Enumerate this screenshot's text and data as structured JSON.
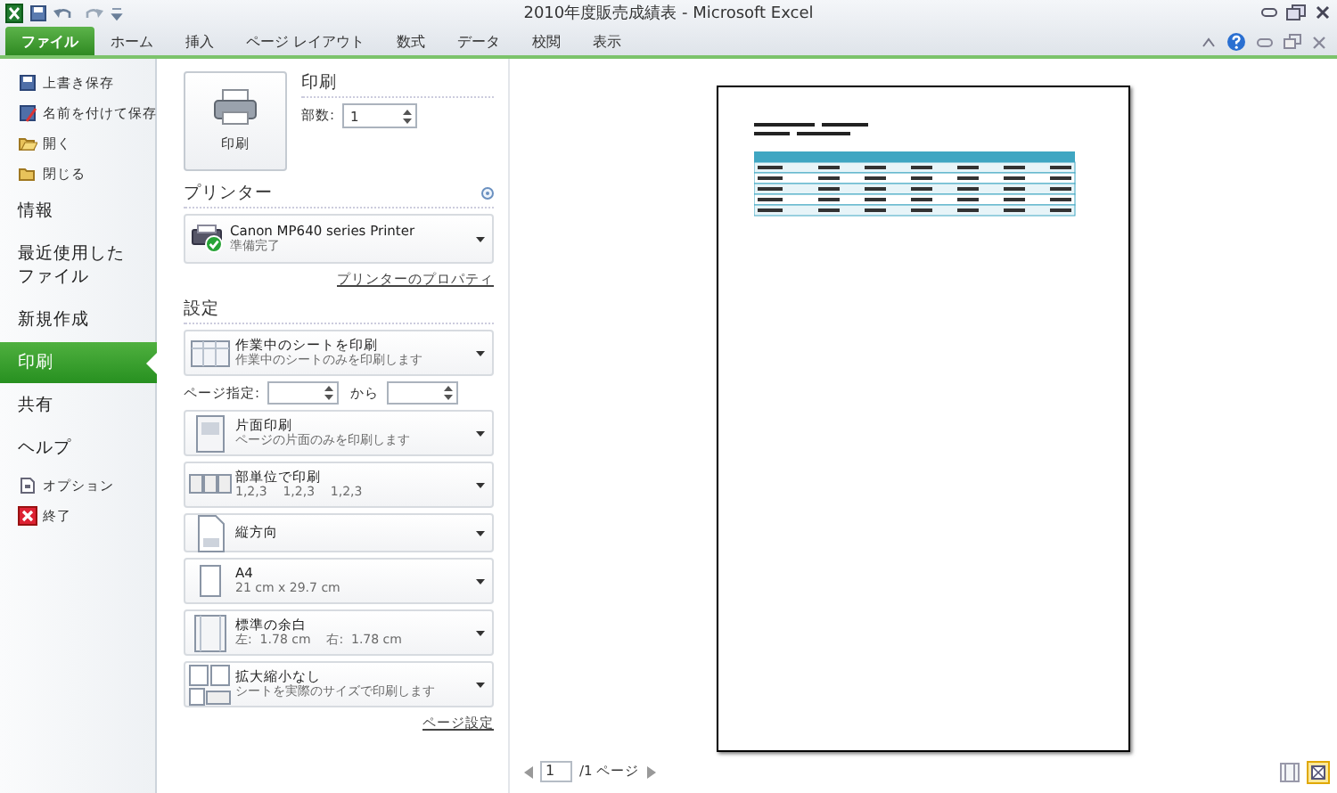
{
  "title_bar": {
    "title": "2010年度販売成績表 - Microsoft Excel"
  },
  "ribbon_tabs": [
    {
      "label": "ファイル",
      "selected": true
    },
    {
      "label": "ホーム",
      "selected": false
    },
    {
      "label": "挿入",
      "selected": false
    },
    {
      "label": "ページ レイアウト",
      "selected": false
    },
    {
      "label": "数式",
      "selected": false
    },
    {
      "label": "データ",
      "selected": false
    },
    {
      "label": "校閲",
      "selected": false
    },
    {
      "label": "表示",
      "selected": false
    }
  ],
  "backstage_nav": [
    {
      "label": "上書き保存",
      "kind": "save",
      "selected": false
    },
    {
      "label": "名前を付けて保存",
      "kind": "saveas",
      "selected": false
    },
    {
      "label": "開く",
      "kind": "open",
      "selected": false
    },
    {
      "label": "閉じる",
      "kind": "close",
      "selected": false
    },
    {
      "label": "情報",
      "kind": "section",
      "selected": false
    },
    {
      "label": "最近使用したファイル",
      "kind": "section",
      "selected": false
    },
    {
      "label": "新規作成",
      "kind": "section",
      "selected": false
    },
    {
      "label": "印刷",
      "kind": "section",
      "selected": true
    },
    {
      "label": "共有",
      "kind": "section",
      "selected": false
    },
    {
      "label": "ヘルプ",
      "kind": "section",
      "selected": false
    },
    {
      "label": "オプション",
      "kind": "options",
      "selected": false
    },
    {
      "label": "終了",
      "kind": "exit",
      "selected": false
    }
  ],
  "print": {
    "button": "印刷",
    "heading": "印刷",
    "copies_label": "部数:",
    "copies": "1"
  },
  "printer": {
    "heading": "プリンター",
    "name": "Canon MP640 series Printer",
    "status": "準備完了",
    "properties_link": "プリンターのプロパティ"
  },
  "settings": {
    "heading": "設定",
    "pages_label": "ページ指定:",
    "to_label": "から",
    "page_setup_link": "ページ設定",
    "options": [
      {
        "kind": "sheet",
        "title": "作業中のシートを印刷",
        "subtitle": "作業中のシートのみを印刷します"
      },
      {
        "kind": "sides",
        "title": "片面印刷",
        "subtitle": "ページの片面のみを印刷します"
      },
      {
        "kind": "collate",
        "title": "部単位で印刷",
        "subtitle": "1,2,3    1,2,3    1,2,3"
      },
      {
        "kind": "orientation",
        "title": "縦方向"
      },
      {
        "kind": "paper",
        "title": "A4",
        "subtitle": "21 cm x 29.7 cm"
      },
      {
        "kind": "margins",
        "title": "標準の余白",
        "subtitle": "左:  1.78 cm    右:  1.78 cm"
      },
      {
        "kind": "scaling",
        "title": "拡大縮小なし",
        "subtitle": "シートを実際のサイズで印刷します"
      }
    ]
  },
  "preview": {
    "page": "1",
    "page_total": "/1 ページ"
  }
}
